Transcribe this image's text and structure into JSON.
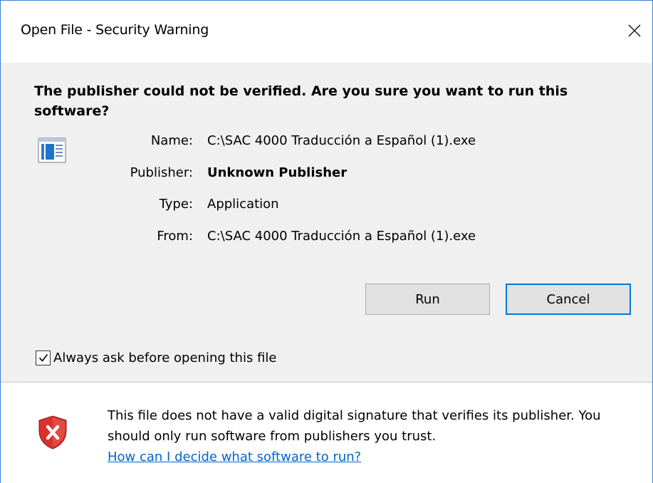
{
  "window": {
    "title": "Open File - Security Warning"
  },
  "headline": "The publisher could not be verified.  Are you sure you want to run this software?",
  "details": [
    {
      "label": "Name:",
      "value": "C:\\SAC 4000 Traducción a Español (1).exe",
      "bold": false
    },
    {
      "label": "Publisher:",
      "value": "Unknown Publisher",
      "bold": true
    },
    {
      "label": "Type:",
      "value": "Application",
      "bold": false
    },
    {
      "label": "From:",
      "value": "C:\\SAC 4000 Traducción a Español (1).exe",
      "bold": false
    }
  ],
  "buttons": {
    "run_label": "Run",
    "cancel_label": "Cancel"
  },
  "checkbox": {
    "label": "Always ask before opening this file",
    "checked": true
  },
  "footer": {
    "message": "This file does not have a valid digital signature that verifies its publisher.  You should only run software from publishers you trust.",
    "link_text": "How can I decide what software to run?"
  },
  "colors": {
    "accent": "#0078d7",
    "link": "#0066cc",
    "shield_red": "#d9322b"
  }
}
